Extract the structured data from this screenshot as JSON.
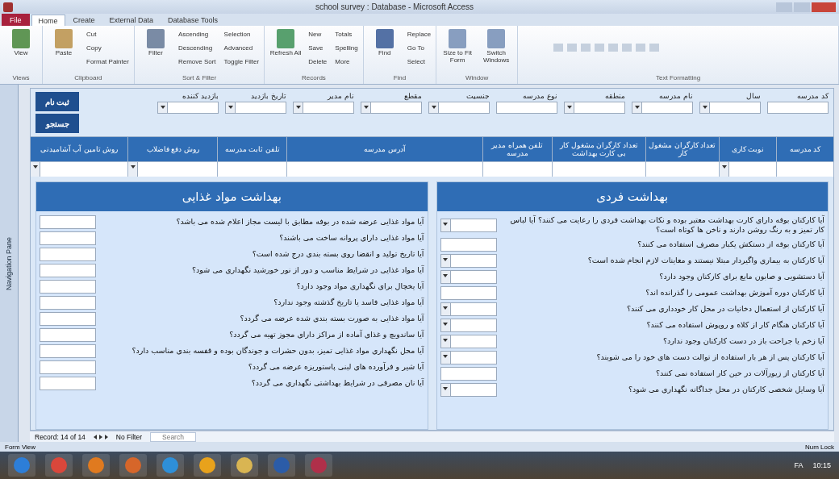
{
  "window": {
    "title": "school survey : Database - Microsoft Access"
  },
  "ribbon_tabs": [
    {
      "label": "Database Tools",
      "selected": false,
      "kind": "tab"
    },
    {
      "label": "External Data",
      "selected": false,
      "kind": "tab"
    },
    {
      "label": "Create",
      "selected": false,
      "kind": "tab"
    },
    {
      "label": "Home",
      "selected": true,
      "kind": "tab"
    },
    {
      "label": "File",
      "selected": false,
      "kind": "file"
    }
  ],
  "ribbon_groups": [
    {
      "label": "Text Formatting"
    },
    {
      "label": "Window",
      "large": [
        "Switch Windows",
        "Size to Fit Form"
      ]
    },
    {
      "label": "Find",
      "large": [
        "Find"
      ],
      "small": [
        "Replace",
        "Go To",
        "Select"
      ]
    },
    {
      "label": "Records",
      "large": [
        "Refresh All"
      ],
      "small": [
        "Totals",
        "Spelling",
        "More",
        "New",
        "Save",
        "Delete"
      ]
    },
    {
      "label": "Sort & Filter",
      "large": [
        "Filter"
      ],
      "small": [
        "Selection",
        "Advanced",
        "Toggle Filter",
        "Ascending",
        "Descending",
        "Remove Sort"
      ]
    },
    {
      "label": "Clipboard",
      "large": [
        "Paste"
      ],
      "small": [
        "Cut",
        "Copy",
        "Format Painter"
      ]
    },
    {
      "label": "Views",
      "large": [
        "View"
      ]
    }
  ],
  "navigation_pane": {
    "label": "Navigation Pane"
  },
  "form": {
    "buttons": [
      "ثبت نام",
      "جستجو"
    ],
    "filters": [
      {
        "label": "کد مدرسه",
        "kind": "text"
      },
      {
        "label": "سال",
        "kind": "combo"
      },
      {
        "label": "نام مدرسه",
        "kind": "combo"
      },
      {
        "label": "منطقه",
        "kind": "combo"
      },
      {
        "label": "نوع مدرسه",
        "kind": "text"
      },
      {
        "label": "جنسیت",
        "kind": "combo"
      },
      {
        "label": "مقطع",
        "kind": "combo"
      },
      {
        "label": "نام مدیر",
        "kind": "combo"
      },
      {
        "label": "تاریخ بازدید",
        "kind": "combo"
      },
      {
        "label": "بازدید کننده",
        "kind": "combo"
      }
    ],
    "columns": [
      {
        "label": "کد مدرسه",
        "kind": "text"
      },
      {
        "label": "نوبت کاری",
        "kind": "combo"
      },
      {
        "label": "تعداد کارگران مشغول کار",
        "kind": "text"
      },
      {
        "label": "تعداد کارگران مشغول کار بی کارت بهداشت",
        "kind": "text"
      },
      {
        "label": "تلفن همراه مدیر مدرسه",
        "kind": "text"
      },
      {
        "label": "آدرس مدرسه",
        "kind": "text"
      },
      {
        "label": "تلفن ثابت مدرسه",
        "kind": "text"
      },
      {
        "label": "روش دفع فاضلاب",
        "kind": "combo"
      },
      {
        "label": "روش تامین آب آشامیدنی",
        "kind": "combo"
      }
    ],
    "panels": [
      {
        "title": "بهداشت فردی",
        "rows": [
          {
            "text": "آیا کارکنان بوفه دارای کارت بهداشت معتبر بوده و نکات بهداشت فردی را رعایت می کنند؟ آیا لباس کار تمیز و به رنگ روشن دارند و ناخن ها کوتاه است؟",
            "kind": "combo"
          },
          {
            "text": "آیا کارکنان بوفه از دستکش یکبار مصرف استفاده می کنند؟",
            "kind": "text"
          },
          {
            "text": "آیا کارکنان به بیماری واگیردار مبتلا نیستند و معاینات لازم انجام شده است؟",
            "kind": "combo"
          },
          {
            "text": "آیا دستشویی و صابون مایع برای کارکنان وجود دارد؟",
            "kind": "combo"
          },
          {
            "text": "آیا کارکنان دوره آموزش بهداشت عمومی را گذرانده اند؟",
            "kind": "text"
          },
          {
            "text": "آیا کارکنان از استعمال دخانیات در محل کار خودداری می کنند؟",
            "kind": "combo"
          },
          {
            "text": "آیا کارکنان هنگام کار از کلاه و روپوش استفاده می کنند؟",
            "kind": "combo"
          },
          {
            "text": "آیا زخم یا جراحت باز در دست کارکنان وجود ندارد؟",
            "kind": "combo"
          },
          {
            "text": "آیا کارکنان پس از هر بار استفاده از توالت دست های خود را می شویند؟",
            "kind": "combo"
          },
          {
            "text": "آیا کارکنان از زیورآلات در حین کار استفاده نمی کنند؟",
            "kind": "text"
          },
          {
            "text": "آیا وسایل شخصی کارکنان در محل جداگانه نگهداری می شود؟",
            "kind": "combo"
          }
        ]
      },
      {
        "title": "بهداشت مواد غذایی",
        "rows": [
          {
            "text": "آیا مواد غذایی عرضه شده در بوفه مطابق با لیست مجاز اعلام شده می باشد؟",
            "kind": "text"
          },
          {
            "text": "آیا مواد غذایی دارای پروانه ساخت می باشند؟",
            "kind": "text"
          },
          {
            "text": "آیا تاریخ تولید و انقضا روی بسته بندی درج شده است؟",
            "kind": "text"
          },
          {
            "text": "آیا مواد غذایی در شرایط مناسب و دور از نور خورشید نگهداری می شود؟",
            "kind": "text"
          },
          {
            "text": "آیا یخچال برای نگهداری مواد وجود دارد؟",
            "kind": "text"
          },
          {
            "text": "آیا مواد غذایی فاسد یا تاریخ گذشته وجود ندارد؟",
            "kind": "text"
          },
          {
            "text": "آیا مواد غذایی به صورت بسته بندی شده عرضه می گردد؟",
            "kind": "text"
          },
          {
            "text": "آیا ساندویچ و غذای آماده از مراکز دارای مجوز تهیه می گردد؟",
            "kind": "text"
          },
          {
            "text": "آیا محل نگهداری مواد غذایی تمیز، بدون حشرات و جوندگان بوده و قفسه بندی مناسب دارد؟",
            "kind": "text"
          },
          {
            "text": "آیا شیر و فرآورده های لبنی پاستوریزه عرضه می گردد؟",
            "kind": "text"
          },
          {
            "text": "آیا نان مصرفی در شرایط بهداشتی نگهداری می گردد؟",
            "kind": "text"
          }
        ]
      }
    ]
  },
  "record_nav": {
    "label": "Record: 14 of 14",
    "filter": "No Filter",
    "search": "Search"
  },
  "status_bar": {
    "left": "Form View",
    "right": "Num Lock"
  },
  "taskbar": {
    "language": "FA",
    "time": "10:15"
  }
}
